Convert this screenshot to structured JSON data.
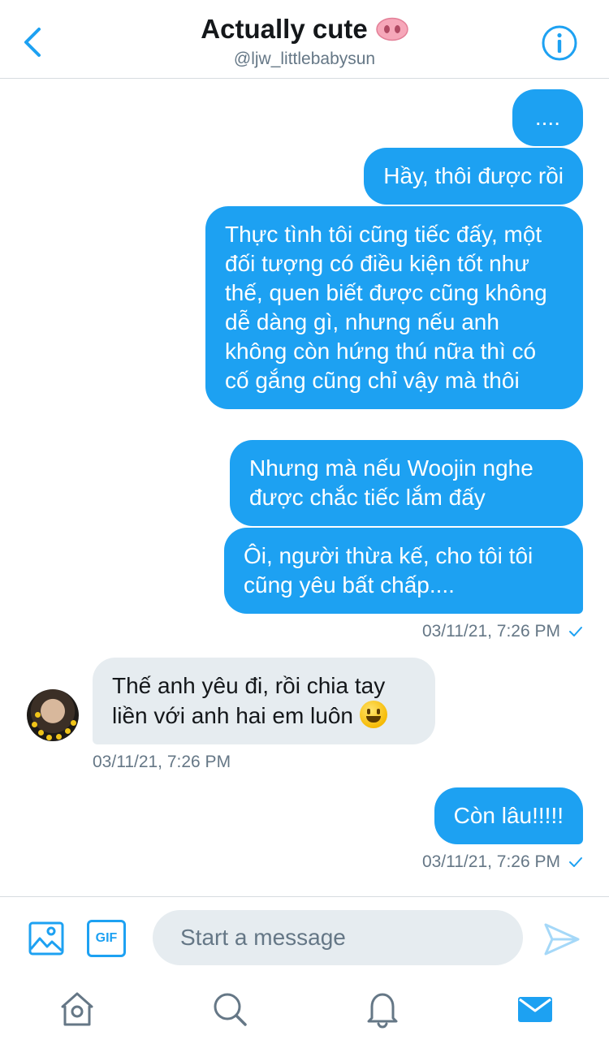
{
  "header": {
    "title": "Actually cute",
    "title_emoji": "pig-nose-icon",
    "handle": "@ljw_littlebabysun"
  },
  "messages": [
    {
      "direction": "out",
      "text": "...."
    },
    {
      "direction": "out",
      "text": "Hầy, thôi được rồi"
    },
    {
      "direction": "out",
      "text": "Thực tình tôi cũng tiếc đấy, một đối tượng có điều kiện tốt như thế, quen biết được cũng không dễ dàng gì, nhưng nếu anh không còn hứng thú nữa thì có cố gắng cũng chỉ vậy mà thôi"
    },
    {
      "direction": "out",
      "text": "Nhưng mà nếu Woojin nghe được chắc tiếc lắm đấy"
    },
    {
      "direction": "out",
      "text": "Ôi, người thừa kế, cho tôi tôi cũng yêu bất chấp...."
    },
    {
      "direction": "in",
      "text": "Thế anh yêu đi, rồi chia tay liền với anh hai em luôn",
      "emoji": "grinning-face-icon"
    },
    {
      "direction": "out",
      "text": "Còn lâu!!!!!"
    }
  ],
  "timestamps": {
    "group1": "03/11/21, 7:26 PM",
    "incoming": "03/11/21, 7:26 PM",
    "group3": "03/11/21, 7:26 PM"
  },
  "composer": {
    "gif_label": "GIF",
    "placeholder": "Start a message"
  },
  "colors": {
    "accent": "#1da1f2",
    "incoming_bubble": "#e6ecf0",
    "secondary_text": "#657786",
    "divider": "#d7dce0"
  },
  "nav": {
    "items": [
      "home-icon",
      "search-icon",
      "notifications-icon",
      "messages-icon"
    ],
    "active": "messages-icon"
  }
}
